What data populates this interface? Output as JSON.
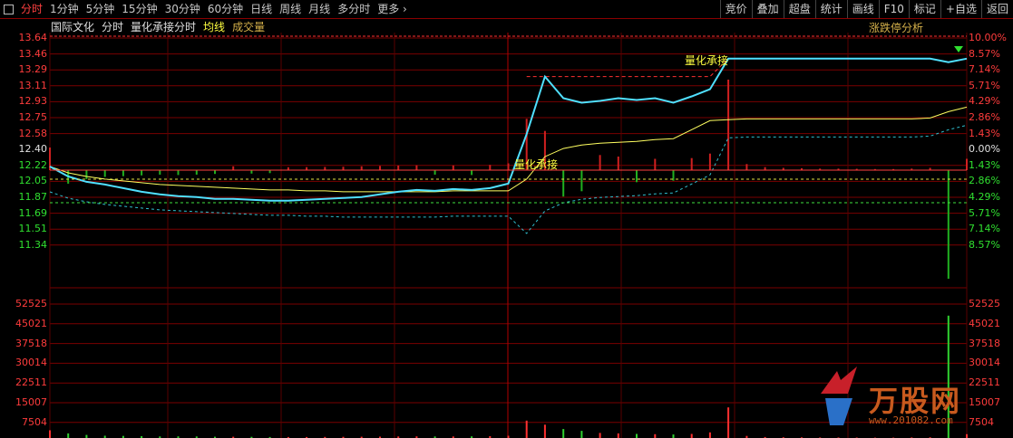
{
  "toolbar": {
    "tabs": [
      "分时",
      "1分钟",
      "5分钟",
      "15分钟",
      "30分钟",
      "60分钟",
      "日线",
      "周线",
      "月线",
      "多分时",
      "更多"
    ],
    "more_chevron": "›",
    "right_buttons": [
      "竞价",
      "叠加",
      "超盘",
      "统计",
      "画线",
      "F10",
      "标记",
      "+自选",
      "返回"
    ]
  },
  "legend": {
    "name": "国际文化",
    "mode": "分时",
    "indicator": "量化承接分时",
    "avg": "均线",
    "volume": "成交量"
  },
  "limit_button": "涨跌停分析",
  "annotations": {
    "upper": "量化承接",
    "lower": "量化承接"
  },
  "price_axis": {
    "left": [
      "13.64",
      "13.46",
      "13.29",
      "13.11",
      "12.93",
      "12.75",
      "12.58",
      "12.40",
      "12.22",
      "12.05",
      "11.87",
      "11.69",
      "11.51",
      "11.34"
    ],
    "right": [
      "10.00%",
      "8.57%",
      "7.14%",
      "5.71%",
      "4.29%",
      "2.86%",
      "1.43%",
      "0.00%",
      "1.43%",
      "2.86%",
      "4.29%",
      "5.71%",
      "7.14%",
      "8.57%"
    ]
  },
  "volume_axis": {
    "left": [
      "52525",
      "45021",
      "37518",
      "30014",
      "22511",
      "15007",
      "7504"
    ],
    "right": [
      "52525",
      "45021",
      "37518",
      "30014",
      "22511",
      "15007",
      "7504"
    ]
  },
  "watermark": {
    "text": "万股网",
    "url": "www.201082.com"
  },
  "chart_data": {
    "type": "line",
    "prev_close": 12.4,
    "ylim": [
      11.16,
      13.64
    ],
    "series": [
      {
        "name": "分时",
        "values": [
          12.44,
          12.33,
          12.27,
          12.24,
          12.2,
          12.16,
          12.13,
          12.11,
          12.1,
          12.08,
          12.08,
          12.07,
          12.06,
          12.06,
          12.07,
          12.08,
          12.09,
          12.1,
          12.13,
          12.16,
          12.18,
          12.17,
          12.19,
          12.18,
          12.2,
          12.25,
          12.8,
          13.44,
          13.2,
          13.15,
          13.17,
          13.2,
          13.18,
          13.2,
          13.15,
          13.22,
          13.3,
          13.64,
          13.64,
          13.64,
          13.64,
          13.64,
          13.64,
          13.64,
          13.64,
          13.64,
          13.64,
          13.64,
          13.64,
          13.6,
          13.64
        ]
      },
      {
        "name": "均线",
        "values": [
          12.44,
          12.37,
          12.33,
          12.3,
          12.28,
          12.26,
          12.24,
          12.23,
          12.22,
          12.21,
          12.2,
          12.19,
          12.18,
          12.18,
          12.17,
          12.17,
          12.16,
          12.16,
          12.16,
          12.16,
          12.16,
          12.16,
          12.17,
          12.17,
          12.17,
          12.17,
          12.3,
          12.55,
          12.64,
          12.68,
          12.7,
          12.71,
          12.72,
          12.74,
          12.75,
          12.85,
          12.95,
          12.96,
          12.97,
          12.97,
          12.97,
          12.97,
          12.97,
          12.97,
          12.97,
          12.97,
          12.97,
          12.97,
          12.98,
          13.05,
          13.1
        ]
      }
    ],
    "volume": [
      3000,
      1800,
      1200,
      900,
      800,
      700,
      600,
      650,
      600,
      500,
      500,
      450,
      400,
      380,
      400,
      420,
      450,
      500,
      550,
      600,
      650,
      600,
      620,
      650,
      700,
      900,
      6800,
      5200,
      3500,
      2800,
      2000,
      1800,
      1600,
      1500,
      1400,
      1600,
      2200,
      12000,
      800,
      400,
      300,
      250,
      200,
      200,
      180,
      150,
      150,
      200,
      300,
      48000,
      1500
    ],
    "volume_ylim": [
      0,
      52525
    ]
  }
}
